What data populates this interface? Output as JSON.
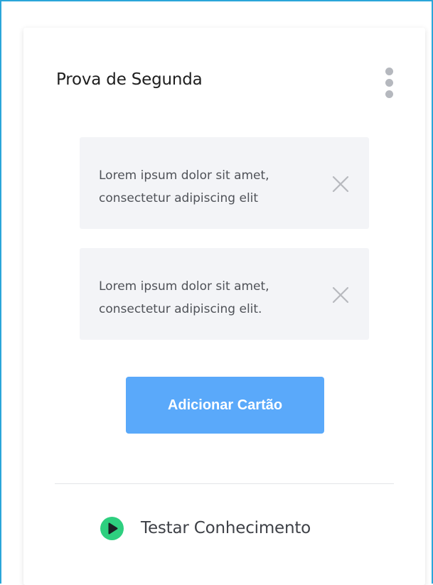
{
  "card": {
    "title": "Prova de Segunda",
    "menu_icon": "more-vertical-icon",
    "notes": [
      {
        "text": "Lorem ipsum dolor sit amet, consectetur adipiscing elit",
        "close_icon": "close-icon"
      },
      {
        "text": "Lorem ipsum dolor sit amet, consectetur adipiscing elit.",
        "close_icon": "close-icon"
      }
    ],
    "add_button_label": "Adicionar Cartão",
    "test_link": {
      "icon": "play-circle-icon",
      "label": "Testar Conhecimento"
    }
  },
  "colors": {
    "frame_border": "#2aa6d9",
    "button_bg": "#5aa9fa",
    "play_icon": "#2ecf7f",
    "note_bg": "#f3f4f7"
  }
}
